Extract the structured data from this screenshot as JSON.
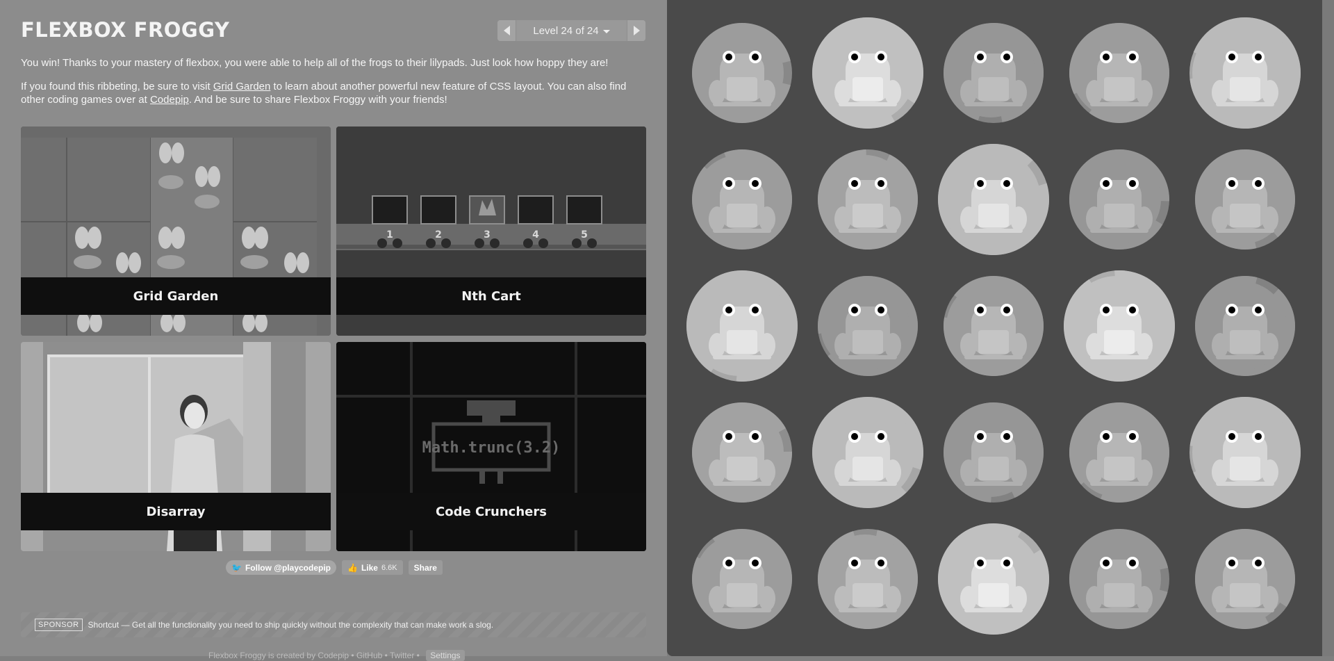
{
  "app": {
    "title": "FLEXBOX FROGGY",
    "level": {
      "label": "Level 24 of 24",
      "prev_icon": "triangle-left-icon",
      "next_icon": "triangle-right-icon"
    }
  },
  "intro": {
    "win_text": "You win! Thanks to your mastery of flexbox, you were able to help all of the frogs to their lilypads. Just look how hoppy they are!",
    "p2_before": "If you found this ribbeting, be sure to visit ",
    "p2_link1": "Grid Garden",
    "p2_middle": " to learn about another powerful new feature of CSS layout. You can also find other coding games over at ",
    "p2_link2": "Codepip",
    "p2_after": ". And be sure to share Flexbox Froggy with your friends!"
  },
  "games": [
    {
      "name": "Grid Garden"
    },
    {
      "name": "Nth Cart"
    },
    {
      "name": "Disarray"
    },
    {
      "name": "Code Crunchers"
    }
  ],
  "tile_texts": {
    "cart_numbers": [
      "1",
      "2",
      "3",
      "4",
      "5"
    ],
    "code_snippet": "Math.trunc(3.2)"
  },
  "social": {
    "follow": "Follow @playcodepip",
    "like": "Like",
    "like_count": "6.6K",
    "share": "Share"
  },
  "sponsor": {
    "tag": "SPONSOR",
    "text": "Shortcut — Get all the functionality you need to ship quickly without the complexity that can make work a slog."
  },
  "footer": {
    "text": "Flexbox Froggy is created by Codepip • GitHub • Twitter •",
    "settings": "Settings"
  },
  "colors": {
    "sidebar_bg": "#8c8c8c",
    "board_bg": "#4a4a4a",
    "label_bar": "#0f0f0f"
  }
}
